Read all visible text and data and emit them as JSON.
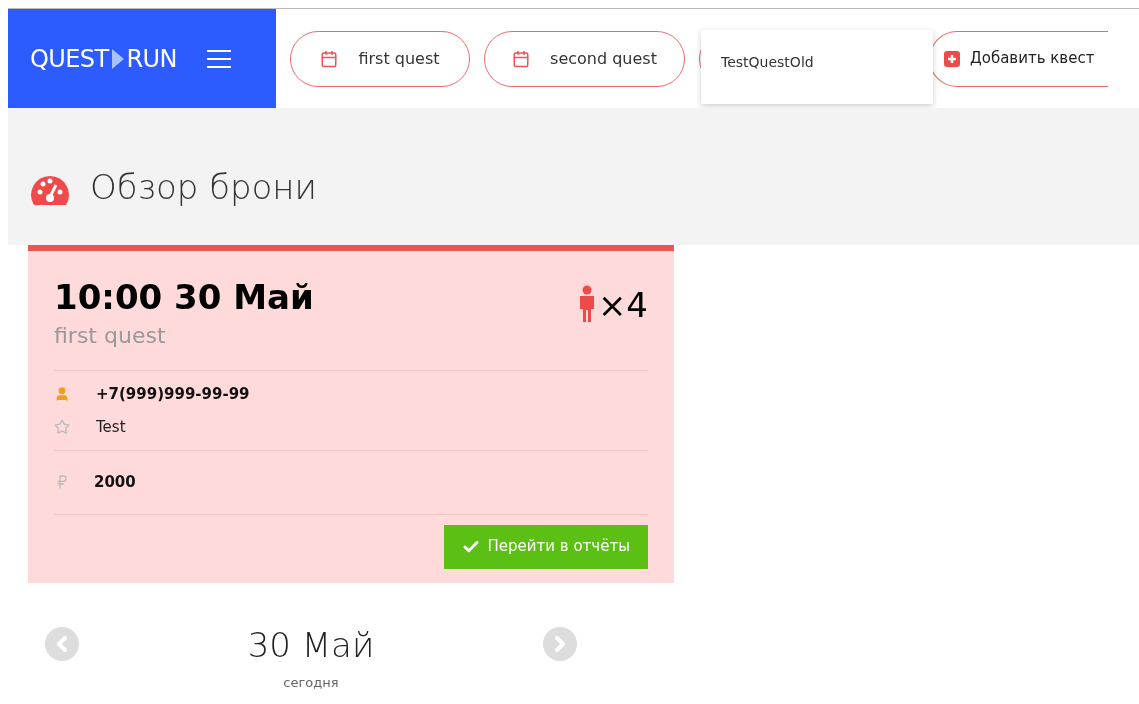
{
  "logo": {
    "left": "QUEST",
    "right": "RUN"
  },
  "tabs": [
    {
      "label": "first quest",
      "selected": false
    },
    {
      "label": "second quest",
      "selected": false
    }
  ],
  "dropdown": {
    "items": [
      {
        "label": "TestQuestOld"
      }
    ]
  },
  "add_button": {
    "label": "Добавить квест"
  },
  "page_title": "Обзор брони",
  "booking": {
    "time": "10:00 30 Май",
    "quest": "first quest",
    "players": "×4",
    "phone": "+7(999)999-99-99",
    "name": "Test",
    "price": "2000",
    "button": "Перейти в отчёты"
  },
  "date_nav": {
    "date": "30 Май",
    "caption": "сегодня"
  }
}
